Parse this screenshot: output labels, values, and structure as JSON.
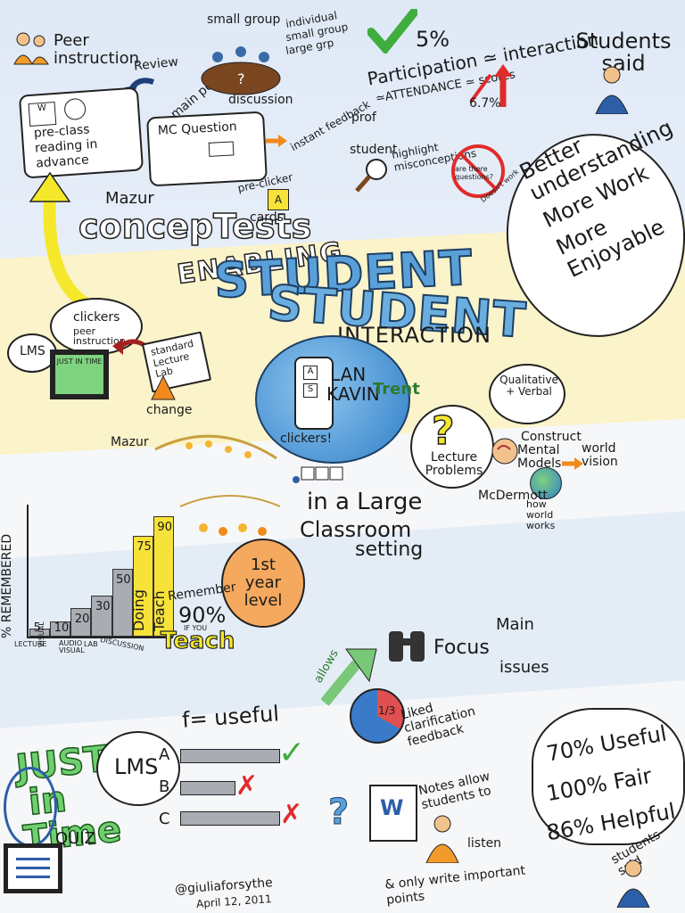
{
  "top_left": {
    "peer_instruction": "Peer instruction",
    "review": "Review",
    "main_points": "main points",
    "preclass": "pre-class reading in advance",
    "doc_label": "doc"
  },
  "top_center": {
    "small_group": "small group",
    "options": [
      "individual",
      "small group",
      "large grp"
    ],
    "discussion": "discussion",
    "mc_question": "MC Question",
    "instant_feedback": "instant feedback",
    "prof": "prof",
    "student": "student",
    "highlight": "highlight misconceptions",
    "are_there": "are there questions?",
    "doesnt_work": "Doesn't work",
    "mazur": "Mazur",
    "concepttests": "concepTests",
    "preclicker": "pre-clicker",
    "cards": "cards",
    "card_letter": "A"
  },
  "top_right": {
    "five_pct": "5%",
    "participation": "Participation ≃ interaction",
    "attendance": "≃ATTENDANCE ≃ scores",
    "six_seven": "6.7%",
    "students_said": "Students said",
    "speech_lines": [
      "Better",
      "understanding",
      "More Work",
      "More Enjoyable"
    ]
  },
  "title": {
    "enabling": "ENABLING",
    "student1": "STUDENT",
    "student2": "STUDENT",
    "interaction": "INTERACTION",
    "alan": "LAN",
    "kavin": "KAVIN",
    "trent": "Trent",
    "a": "A",
    "s": "S",
    "clickers": "clickers!"
  },
  "left_mid": {
    "clickers": "clickers",
    "peer_instruction": "peer instruction",
    "lms": "LMS",
    "just_in_time": "JUST IN TIME",
    "standard": "standard Lecture Lab",
    "change": "change",
    "mazur": "Mazur"
  },
  "right_mid": {
    "lecture_problems": "Lecture Problems",
    "qualitative": "Qualitative + Verbal",
    "construct": "Construct",
    "mental_models": "Mental Models",
    "world_vision": "world vision",
    "mcdermott": "McDermott",
    "how_world_works": "how world works"
  },
  "center": {
    "large": "in a Large",
    "classroom": "Classroom",
    "setting": "setting",
    "first_year": "1st year level"
  },
  "chart_data": {
    "type": "bar",
    "ylabel": "% REMEMBERED",
    "categories": [
      "LECTURE",
      "VISUAL",
      "AUDIO VISUAL",
      "LAB",
      "DISCUSSION",
      "Doing",
      "Teach"
    ],
    "values": [
      5,
      10,
      20,
      30,
      50,
      75,
      90
    ],
    "value_labels": [
      "5",
      "10",
      "20",
      "30",
      "50",
      "75",
      "90"
    ],
    "category_labels": [
      "LECTURE",
      "VISUAL",
      "AUDIO VISUAL",
      "LAB",
      "DISCUSSION",
      "Doing",
      "Teach"
    ],
    "ylim": [
      0,
      100
    ],
    "highlight_color": "#f7e23a"
  },
  "remember": {
    "remember": "Remember",
    "pct": "90%",
    "if_you": "IF YOU",
    "teach": "Teach"
  },
  "focus": {
    "allows": "allows",
    "focus": "Focus",
    "main": "Main",
    "issues": "issues"
  },
  "bottom_left": {
    "jit_lines": [
      "JUST",
      "in",
      "Time"
    ],
    "quiz": "QUIZ",
    "lms": "LMS",
    "useful": "f= useful",
    "rows": [
      {
        "letter": "A",
        "mark": "✓",
        "color": "#3fae3f"
      },
      {
        "letter": "B",
        "mark": "✗",
        "color": "#e02b2b"
      },
      {
        "letter": "C",
        "mark": "✗",
        "color": "#e02b2b"
      }
    ],
    "author": "@giuliaforsythe",
    "date": "April 12, 2011"
  },
  "bottom_right": {
    "liked": "Liked clarification feedback",
    "pie_label": "1/3",
    "notes": "Notes allow students to",
    "listen": "listen",
    "only_write": "& only write important points",
    "speech_lines": [
      "70% Useful",
      "100% Fair",
      "86% Helpful"
    ],
    "students_said": "students said"
  }
}
